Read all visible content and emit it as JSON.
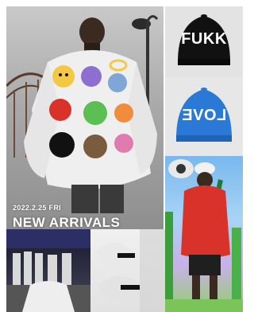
{
  "hero": {
    "date": "2022.2.25 FRI",
    "headline": "NEW ARRIVALS"
  },
  "caps": [
    {
      "text": "FUKK"
    },
    {
      "text": "LOVE"
    }
  ],
  "colors": {
    "cap_black": "#111111",
    "cap_blue": "#2a79d6",
    "hoodie_red": "#d8322a",
    "hoodie_white": "#efefef"
  }
}
